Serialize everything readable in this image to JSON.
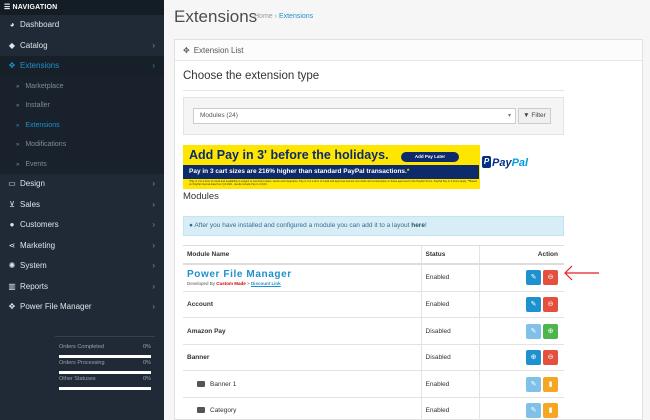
{
  "nav": {
    "header": "NAVIGATION",
    "items": [
      {
        "label": "Dashboard",
        "icon": "dashboard-icon",
        "chevron": false
      },
      {
        "label": "Catalog",
        "icon": "tag-icon",
        "chevron": true
      },
      {
        "label": "Extensions",
        "icon": "puzzle-icon",
        "chevron": true,
        "active": true
      }
    ],
    "sub_items": [
      {
        "label": "Marketplace"
      },
      {
        "label": "Installer"
      },
      {
        "label": "Extensions",
        "active": true
      },
      {
        "label": "Modifications"
      },
      {
        "label": "Events"
      }
    ],
    "items2": [
      {
        "label": "Design",
        "icon": "monitor-icon",
        "chevron": true
      },
      {
        "label": "Sales",
        "icon": "cart-icon",
        "chevron": true
      },
      {
        "label": "Customers",
        "icon": "user-icon",
        "chevron": true
      },
      {
        "label": "Marketing",
        "icon": "share-icon",
        "chevron": true
      },
      {
        "label": "System",
        "icon": "gear-icon",
        "chevron": true
      },
      {
        "label": "Reports",
        "icon": "bar-chart-icon",
        "chevron": true
      },
      {
        "label": "Power File Manager",
        "icon": "puzzle-icon",
        "chevron": true
      }
    ],
    "progress": [
      {
        "label": "Orders Completed",
        "value": "0%",
        "fraction": 0
      },
      {
        "label": "Orders Processing",
        "value": "0%",
        "fraction": 0
      },
      {
        "label": "Other Statuses",
        "value": "0%",
        "fraction": 0
      }
    ]
  },
  "page": {
    "title": "Extensions",
    "breadcrumb": {
      "home": "Home",
      "sep": "›",
      "current": "Extensions"
    }
  },
  "panel": {
    "heading": "Extension List",
    "choose_label": "Choose the extension type",
    "select_value": "Modules (24)",
    "filter_label": "Filter"
  },
  "ad": {
    "line1": "Add Pay in 3' before the holidays.",
    "pill": "Add Pay Later",
    "line2_a": "Pay in 3 cart sizes are 216% higher than standard PayPal transactions.",
    "line2_b": "*",
    "fine": "*Pay in 3 is a form of credit and availability is subject to merchant status, sector and integration. Pay in 3 is a form of credit and approval and are not credit card consumption or those approved in the PayPal Terms. PayPal Pay in 3 terms apply. **Based on PayPal internal data from Q1 2021, results include Pay in 3 (UK).",
    "brand_a": "Pay",
    "brand_b": "Pal"
  },
  "modules": {
    "heading": "Modules",
    "info_text": "After you have installed and configured a module you can add it to a layout",
    "info_link": "here",
    "info_end": "!",
    "columns": {
      "name": "Module Name",
      "status": "Status",
      "action": "Action"
    },
    "rows": [
      {
        "name": "Power File Manager",
        "special": true,
        "dev_prefix": "Developed By ",
        "dev_name": "Custom Made",
        "dev_sep": " > ",
        "dev_link": "Discount Link",
        "status": "Enabled",
        "buttons": [
          {
            "icon": "pencil-icon",
            "color": "blue"
          },
          {
            "icon": "minus-circle-icon",
            "color": "red"
          }
        ]
      },
      {
        "name": "Account",
        "status": "Enabled",
        "buttons": [
          {
            "icon": "pencil-icon",
            "color": "blue"
          },
          {
            "icon": "minus-circle-icon",
            "color": "red"
          }
        ]
      },
      {
        "name": "Amazon Pay",
        "status": "Disabled",
        "buttons": [
          {
            "icon": "pencil-icon",
            "color": "lightblue"
          },
          {
            "icon": "plus-circle-icon",
            "color": "green"
          }
        ]
      },
      {
        "name": "Banner",
        "status": "Disabled",
        "buttons": [
          {
            "icon": "plus-circle-icon",
            "color": "blue"
          },
          {
            "icon": "minus-circle-icon",
            "color": "red"
          }
        ]
      },
      {
        "name": "Banner 1",
        "child": true,
        "status": "Enabled",
        "buttons": [
          {
            "icon": "pencil-icon",
            "color": "lightblue"
          },
          {
            "icon": "trash-icon",
            "color": "orange"
          }
        ]
      },
      {
        "name": "Category",
        "child": true,
        "status": "Enabled",
        "buttons": [
          {
            "icon": "pencil-icon",
            "color": "lightblue"
          },
          {
            "icon": "trash-icon",
            "color": "orange"
          }
        ]
      }
    ]
  },
  "colors": {
    "accent": "#1e91cf",
    "sidebar": "#1f2a36",
    "annotation": "#e02020"
  }
}
